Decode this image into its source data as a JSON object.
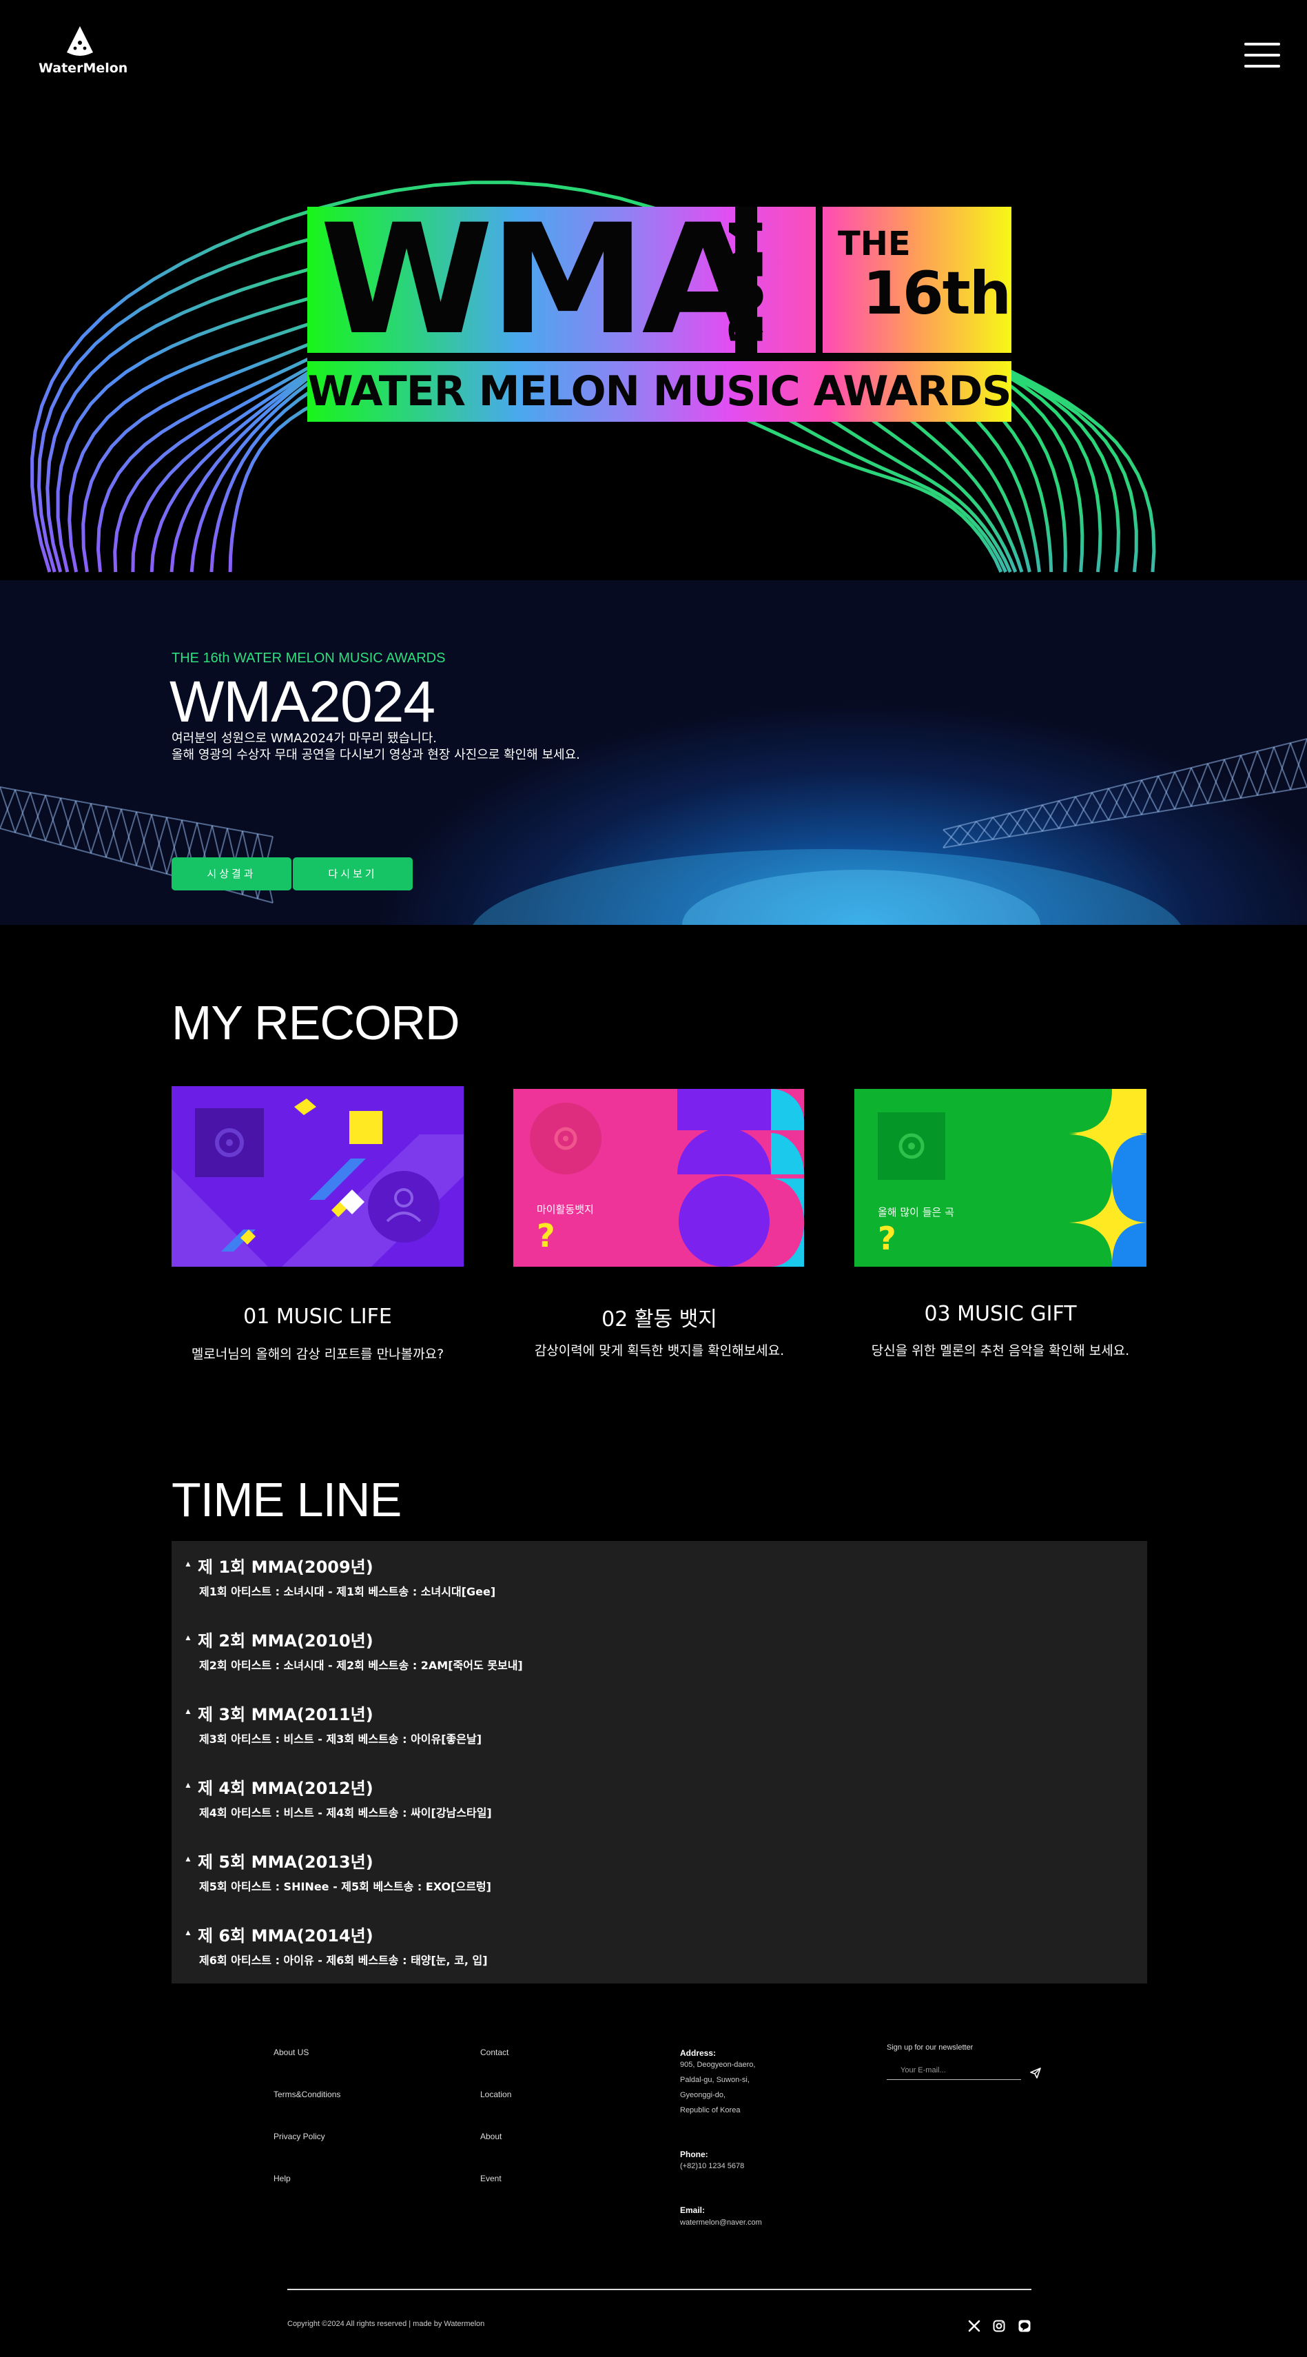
{
  "header": {
    "logo_text": "WaterMelon"
  },
  "hero": {
    "logo_main": "WMA",
    "logo_year": "2024",
    "logo_the": "THE",
    "logo_edition": "16th",
    "logo_subtitle": "WATER MELON MUSIC AWARDS"
  },
  "stage": {
    "eyebrow": "THE 16th WATER MELON MUSIC AWARDS",
    "title": "WMA2024",
    "desc_line1": "여러분의 성원으로 WMA2024가 마무리 됐습니다.",
    "desc_line2": "올해 영광의 수상자 무대 공연을 다시보기 영상과 현장 사진으로 확인해 보세요.",
    "btn_results": "시상결과",
    "btn_replay": "다시보기"
  },
  "my_record": {
    "title": "MY RECORD",
    "cards": [
      {
        "title": "01 MUSIC LIFE",
        "desc": "멜로너님의 올해의 감상 리포트를 만나볼까요?",
        "overlay": "",
        "mark": ""
      },
      {
        "title": "02 활동 뱃지",
        "desc": "감상이력에 맞게 획득한 뱃지를 확인해보세요.",
        "overlay": "마이활동뱃지",
        "mark": "?"
      },
      {
        "title": "03 MUSIC GIFT",
        "desc": "당신을 위한 멜론의 추천 음악을 확인해 보세요.",
        "overlay": "올해 많이 들은 곡",
        "mark": "?"
      }
    ]
  },
  "timeline": {
    "title": "TIME LINE",
    "items": [
      {
        "title": "제 1회 MMA(2009년)",
        "desc": "제1회 아티스트 : 소녀시대 - 제1회 베스트송 : 소녀시대[Gee]"
      },
      {
        "title": "제 2회 MMA(2010년)",
        "desc": "제2회 아티스트 : 소녀시대 - 제2회 베스트송 : 2AM[죽어도 못보내]"
      },
      {
        "title": "제 3회 MMA(2011년)",
        "desc": "제3회 아티스트 : 비스트 - 제3회 베스트송 : 아이유[좋은날]"
      },
      {
        "title": "제 4회 MMA(2012년)",
        "desc": "제4회 아티스트 : 비스트 - 제4회 베스트송 : 싸이[강남스타일]"
      },
      {
        "title": "제 5회 MMA(2013년)",
        "desc": "제5회 아티스트 : SHINee - 제5회 베스트송 : EXO[으르렁]"
      },
      {
        "title": "제 6회 MMA(2014년)",
        "desc": "제6회 아티스트 : 아이유 - 제6회 베스트송 : 태양[눈, 코, 입]"
      }
    ]
  },
  "footer": {
    "col1": [
      "About US",
      "Terms&Conditions",
      "Privacy Policy",
      "Help"
    ],
    "col2": [
      "Contact",
      "Location",
      "About",
      "Event"
    ],
    "address_label": "Address:",
    "address_lines": [
      "905, Deogyeon-daero,",
      "Paldal-gu, Suwon-si,",
      "Gyeonggi-do,",
      "Republic of Korea"
    ],
    "phone_label": "Phone:",
    "phone": "(+82)10 1234 5678",
    "email_label": "Email:",
    "email": "watermelon@naver.com",
    "newsletter_label": "Sign up for our newsletter",
    "newsletter_placeholder": "Your E-mail...",
    "copyright": "Copyright ©2024 All rights reserved | made by Watermelon"
  },
  "icons": [
    "watermelon-logo-icon",
    "hamburger-menu-icon",
    "vinyl-icon",
    "user-icon",
    "send-icon",
    "x-twitter-icon",
    "instagram-icon",
    "line-icon"
  ],
  "colors": {
    "accent_green": "#16c466",
    "eyebrow_green": "#2ee07d",
    "card1_bg": "#6a1ee6",
    "card2_bg": "#ee3399",
    "card3_bg": "#0db22f",
    "timeline_bg": "#1f1f1f"
  }
}
